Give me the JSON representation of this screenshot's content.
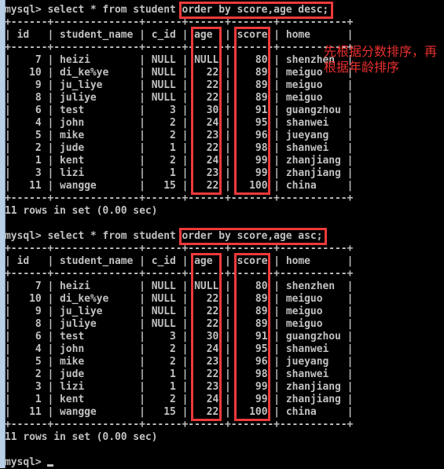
{
  "window": {
    "type": "mysql-console"
  },
  "prompt": "mysql>",
  "queries": [
    {
      "base": "select * from student ",
      "highlighted": "order by score,age desc;",
      "columns": [
        "id",
        "student_name",
        "c_id",
        "age",
        "score",
        "home"
      ],
      "rows": [
        [
          "7",
          "heizi",
          "NULL",
          "NULL",
          "80",
          "shenzhen"
        ],
        [
          "10",
          "di_ke%ye",
          "NULL",
          "22",
          "89",
          "meiguo"
        ],
        [
          "9",
          "ju_liye",
          "NULL",
          "22",
          "89",
          "meiguo"
        ],
        [
          "8",
          "juliye",
          "NULL",
          "22",
          "89",
          "meiguo"
        ],
        [
          "6",
          "test",
          "3",
          "30",
          "91",
          "guangzhou"
        ],
        [
          "4",
          "john",
          "2",
          "24",
          "95",
          "shanwei"
        ],
        [
          "5",
          "mike",
          "2",
          "23",
          "96",
          "jueyang"
        ],
        [
          "2",
          "jude",
          "1",
          "22",
          "98",
          "shanwei"
        ],
        [
          "1",
          "kent",
          "2",
          "24",
          "99",
          "zhanjiang"
        ],
        [
          "3",
          "lizi",
          "1",
          "23",
          "99",
          "zhanjiang"
        ],
        [
          "11",
          "wangge",
          "15",
          "22",
          "100",
          "china"
        ]
      ],
      "summary": "11 rows in set (0.00 sec)"
    },
    {
      "base": "select * from student ",
      "highlighted": "order by score,age asc;",
      "columns": [
        "id",
        "student_name",
        "c_id",
        "age",
        "score",
        "home"
      ],
      "rows": [
        [
          "7",
          "heizi",
          "NULL",
          "NULL",
          "80",
          "shenzhen"
        ],
        [
          "10",
          "di_ke%ye",
          "NULL",
          "22",
          "89",
          "meiguo"
        ],
        [
          "9",
          "ju_liye",
          "NULL",
          "22",
          "89",
          "meiguo"
        ],
        [
          "8",
          "juliye",
          "NULL",
          "22",
          "89",
          "meiguo"
        ],
        [
          "6",
          "test",
          "3",
          "30",
          "91",
          "guangzhou"
        ],
        [
          "4",
          "john",
          "2",
          "24",
          "95",
          "shanwei"
        ],
        [
          "5",
          "mike",
          "2",
          "23",
          "96",
          "jueyang"
        ],
        [
          "2",
          "jude",
          "1",
          "22",
          "98",
          "shanwei"
        ],
        [
          "3",
          "lizi",
          "1",
          "23",
          "99",
          "zhanjiang"
        ],
        [
          "1",
          "kent",
          "2",
          "24",
          "99",
          "zhanjiang"
        ],
        [
          "11",
          "wangge",
          "15",
          "22",
          "100",
          "china"
        ]
      ],
      "summary": "11 rows in set (0.00 sec)"
    }
  ],
  "annotation": "先根据分数排序，再根据年龄排序",
  "colors": {
    "terminal_bg": "#000000",
    "terminal_text": "#c0c0c0",
    "highlight": "#ee3a3a",
    "annotation": "#e8302e"
  }
}
